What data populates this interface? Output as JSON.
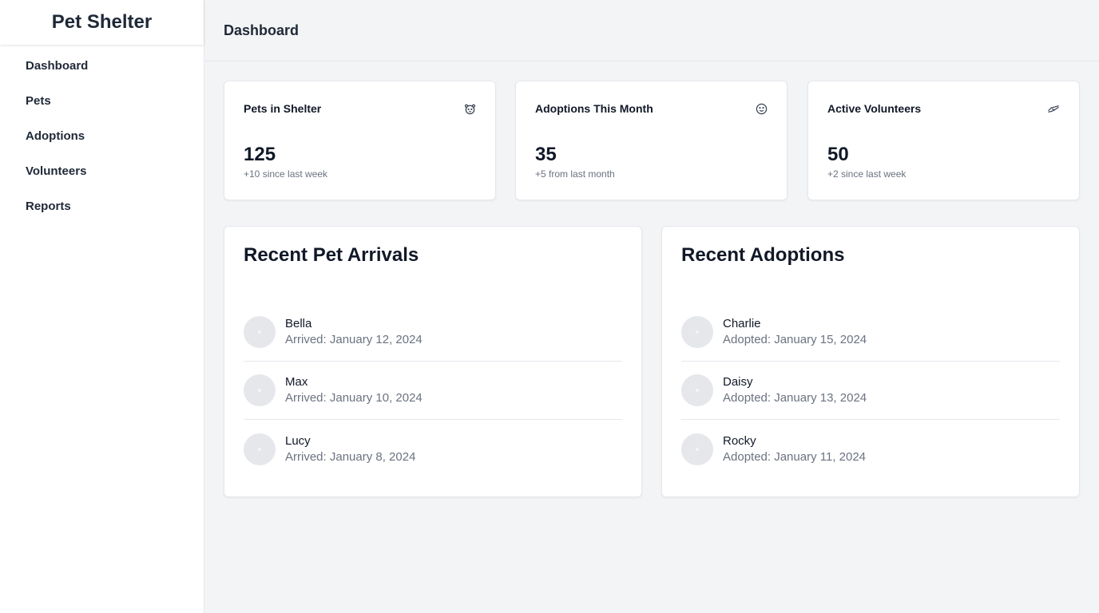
{
  "sidebar": {
    "brand": "Pet Shelter",
    "items": [
      {
        "label": "Dashboard"
      },
      {
        "label": "Pets"
      },
      {
        "label": "Adoptions"
      },
      {
        "label": "Volunteers"
      },
      {
        "label": "Reports"
      }
    ]
  },
  "header": {
    "title": "Dashboard"
  },
  "stats": [
    {
      "title": "Pets in Shelter",
      "value": "125",
      "sub": "+10 since last week",
      "icon": "paw-icon"
    },
    {
      "title": "Adoptions This Month",
      "value": "35",
      "sub": "+5 from last month",
      "icon": "smile-icon"
    },
    {
      "title": "Active Volunteers",
      "value": "50",
      "sub": "+2 since last week",
      "icon": "handshake-icon"
    }
  ],
  "arrivals": {
    "title": "Recent Pet Arrivals",
    "items": [
      {
        "name": "Bella",
        "date": "Arrived: January 12, 2024"
      },
      {
        "name": "Max",
        "date": "Arrived: January 10, 2024"
      },
      {
        "name": "Lucy",
        "date": "Arrived: January 8, 2024"
      }
    ]
  },
  "adoptions": {
    "title": "Recent Adoptions",
    "items": [
      {
        "name": "Charlie",
        "date": "Adopted: January 15, 2024"
      },
      {
        "name": "Daisy",
        "date": "Adopted: January 13, 2024"
      },
      {
        "name": "Rocky",
        "date": "Adopted: January 11, 2024"
      }
    ]
  }
}
